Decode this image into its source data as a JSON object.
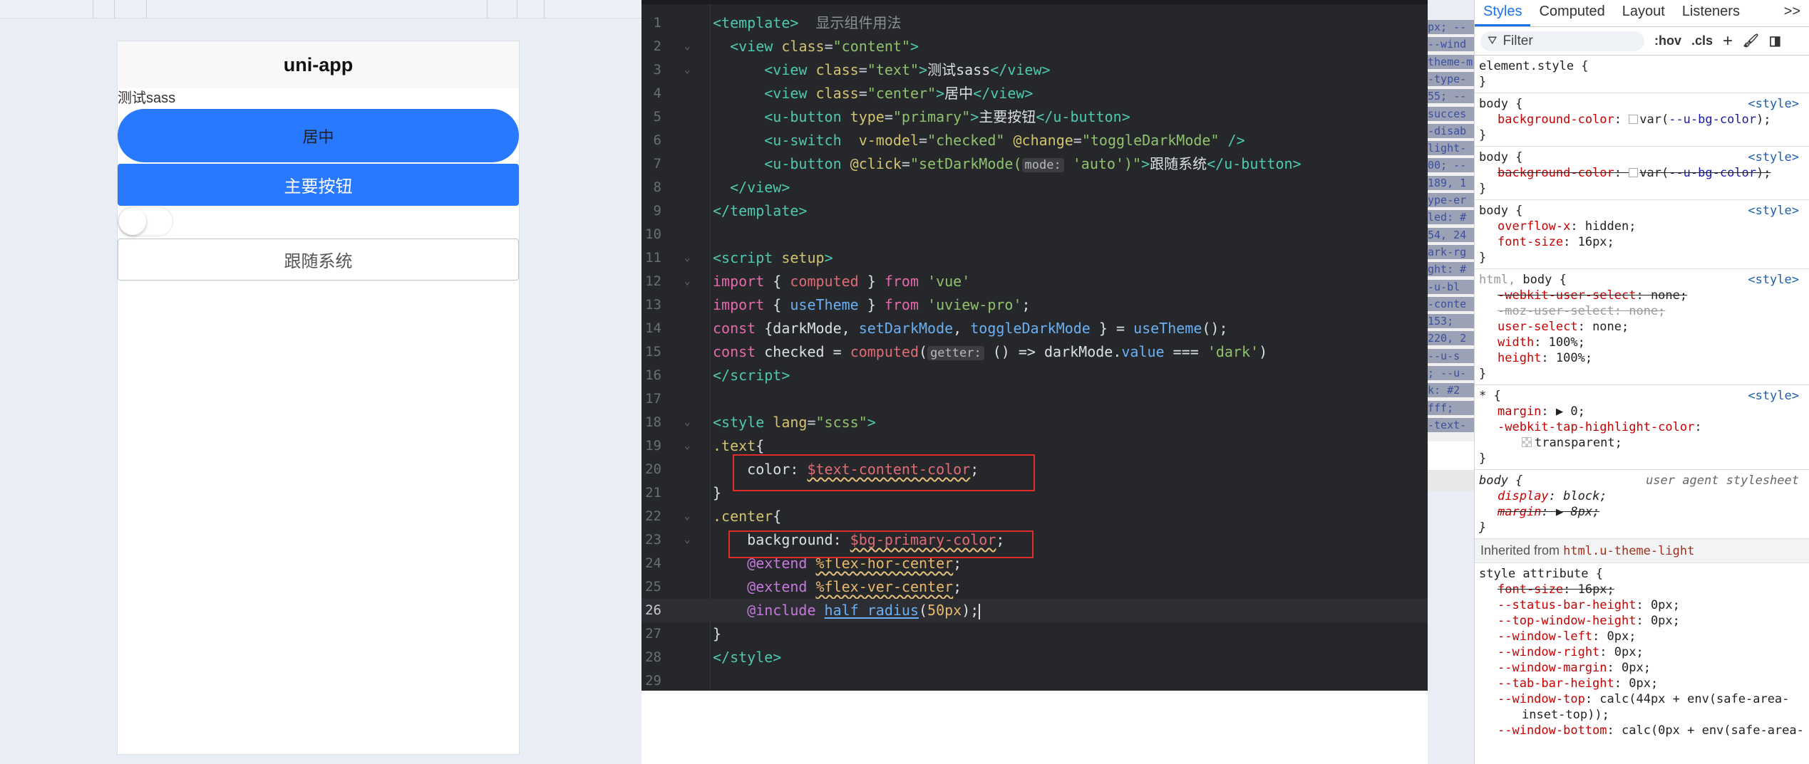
{
  "preview": {
    "nav_title": "uni-app",
    "test_text": "测试sass",
    "center_text": "居中",
    "primary_button": "主要按钮",
    "follow_button": "跟随系统",
    "switch_checked": false,
    "colors": {
      "primary": "#2979ff",
      "nav_bg": "#f8f8f8"
    }
  },
  "editor": {
    "lines": [
      {
        "n": "1",
        "html": "<span class='tg'>&lt;template&gt;</span>  <span class='cm'>显示组件用法</span>"
      },
      {
        "n": "2",
        "html": "  <span class='tg'>&lt;view</span> <span class='at'>class</span>=<span class='st2'>\"content\"</span><span class='tg'>&gt;</span>"
      },
      {
        "n": "3",
        "html": "      <span class='tg'>&lt;view</span> <span class='at'>class</span>=<span class='st2'>\"text\"</span><span class='tg'>&gt;</span><span class='id'>测试sass</span><span class='tg'>&lt;/view&gt;</span>"
      },
      {
        "n": "4",
        "html": "      <span class='tg'>&lt;view</span> <span class='at'>class</span>=<span class='st2'>\"center\"</span><span class='tg'>&gt;</span><span class='id'>居中</span><span class='tg'>&lt;/view&gt;</span>"
      },
      {
        "n": "5",
        "html": "      <span class='tg'>&lt;u-button</span> <span class='at'>type</span>=<span class='st2'>\"primary\"</span><span class='tg'>&gt;</span><span class='id'>主要按钮</span><span class='tg'>&lt;/u-button&gt;</span>"
      },
      {
        "n": "6",
        "html": "      <span class='tg'>&lt;u-switch</span>  <span class='at'>v-model</span>=<span class='st2'>\"checked\"</span> <span class='at'>@change</span>=<span class='st2'>\"toggleDarkMode\"</span> <span class='tg'>/&gt;</span>"
      },
      {
        "n": "7",
        "html": "      <span class='tg'>&lt;u-button</span> <span class='at'>@click</span>=<span class='st2'>\"setDarkMode(</span><span class='hint'>mode:</span> <span class='st2'>'auto')\"</span><span class='tg'>&gt;</span><span class='id'>跟随系统</span><span class='tg'>&lt;/u-button&gt;</span>"
      },
      {
        "n": "8",
        "html": "  <span class='tg'>&lt;/view&gt;</span>"
      },
      {
        "n": "9",
        "html": "<span class='tg'>&lt;/template&gt;</span>"
      },
      {
        "n": "10",
        "html": ""
      },
      {
        "n": "11",
        "html": "<span class='tg'>&lt;script</span> <span class='at'>setup</span><span class='tg'>&gt;</span>"
      },
      {
        "n": "12",
        "html": "<span class='kw'>import</span> <span class='id'>{ </span><span class='vr' style='text-decoration:none;color:#e06c75'>computed</span><span class='id'> } </span><span class='kw'>from</span> <span class='st2'>'vue'</span>"
      },
      {
        "n": "13",
        "html": "<span class='kw'>import</span> <span class='id'>{ </span><span class='fn'>useTheme</span><span class='id'> } </span><span class='kw'>from</span> <span class='st2'>'uview-pro'</span><span class='id'>;</span>"
      },
      {
        "n": "14",
        "html": "<span class='kw'>const</span> <span class='id'>{darkMode, </span><span class='fn'>setDarkMode</span><span class='id'>, </span><span class='fn'>toggleDarkMode</span><span class='id'> } = </span><span class='fn'>useTheme</span><span class='id'>();</span>"
      },
      {
        "n": "15",
        "html": "<span class='kw'>const</span> <span class='id'>checked = </span><span class='vr' style='text-decoration:none;color:#e06c75'>computed</span><span class='id'>(</span><span class='hint'>getter:</span><span class='id'> () =&gt; darkMode.</span><span class='fn'>value</span><span class='id'> === </span><span class='st2'>'dark'</span><span class='id'>)</span>"
      },
      {
        "n": "16",
        "html": "<span class='tg'>&lt;/script&gt;</span>"
      },
      {
        "n": "17",
        "html": ""
      },
      {
        "n": "18",
        "html": "<span class='tg'>&lt;style</span> <span class='at'>lang</span>=<span class='st2'>\"scss\"</span><span class='tg'>&gt;</span>"
      },
      {
        "n": "19",
        "html": "<span class='at'>.text</span><span class='id'>{</span>"
      },
      {
        "n": "20",
        "html": "    <span class='id'>color: </span><span class='vr'>$text-content-color</span><span class='id'>;</span>"
      },
      {
        "n": "21",
        "html": "<span class='id'>}</span>"
      },
      {
        "n": "22",
        "html": "<span class='at'>.center</span><span class='id'>{</span>"
      },
      {
        "n": "23",
        "html": "    <span class='id'>background: </span><span class='vr'>$bg-primary-color</span><span class='id'>;</span>"
      },
      {
        "n": "24",
        "html": "    <span class='ex'>@extend</span> <span class='ph'>%flex-hor-center</span><span class='id'>;</span>"
      },
      {
        "n": "25",
        "html": "    <span class='ex'>@extend</span> <span class='ph'>%flex-ver-center</span><span class='id'>;</span>"
      },
      {
        "n": "26",
        "html": "    <span class='ex'>@include</span> <span class='lnk'>half_radius</span><span class='id'>(</span><span class='nm'>50px</span><span class='id'>);</span><span class='cursor'></span>"
      },
      {
        "n": "27",
        "html": "<span class='id'>}</span>"
      },
      {
        "n": "28",
        "html": "<span class='tg'>&lt;/style&gt;</span>"
      },
      {
        "n": "29",
        "html": ""
      }
    ],
    "active_line": 26,
    "fold_lines": [
      2,
      3,
      11,
      12,
      18,
      19,
      22,
      23
    ]
  },
  "console_strip": [
    "px; --",
    "--wind",
    "theme-m",
    "-type-",
    "55; --",
    "succes",
    "-disab",
    "light-",
    "00; --",
    "189, 1",
    "ype-er",
    "led: #",
    "54, 24",
    "ark-rg",
    "ght: #",
    "-u-bl",
    "-conte",
    "153; ",
    "220, 2",
    "--u-s",
    "; --u-",
    "k: #2",
    "fff; ",
    "-text-"
  ],
  "devtools": {
    "tabs": [
      "Styles",
      "Computed",
      "Layout",
      "Event Listeners",
      ">>"
    ],
    "active_tab": "Styles",
    "filter_placeholder": "Filter",
    "toolbar": [
      ":hov",
      ".cls",
      "+"
    ],
    "element_style": "element.style {",
    "src_style": "<style>",
    "src_ua": "user agent stylesheet",
    "inherited_label": "Inherited from",
    "inherited_selector": "html.u-theme-light",
    "style_attr": "style attribute {"
  }
}
